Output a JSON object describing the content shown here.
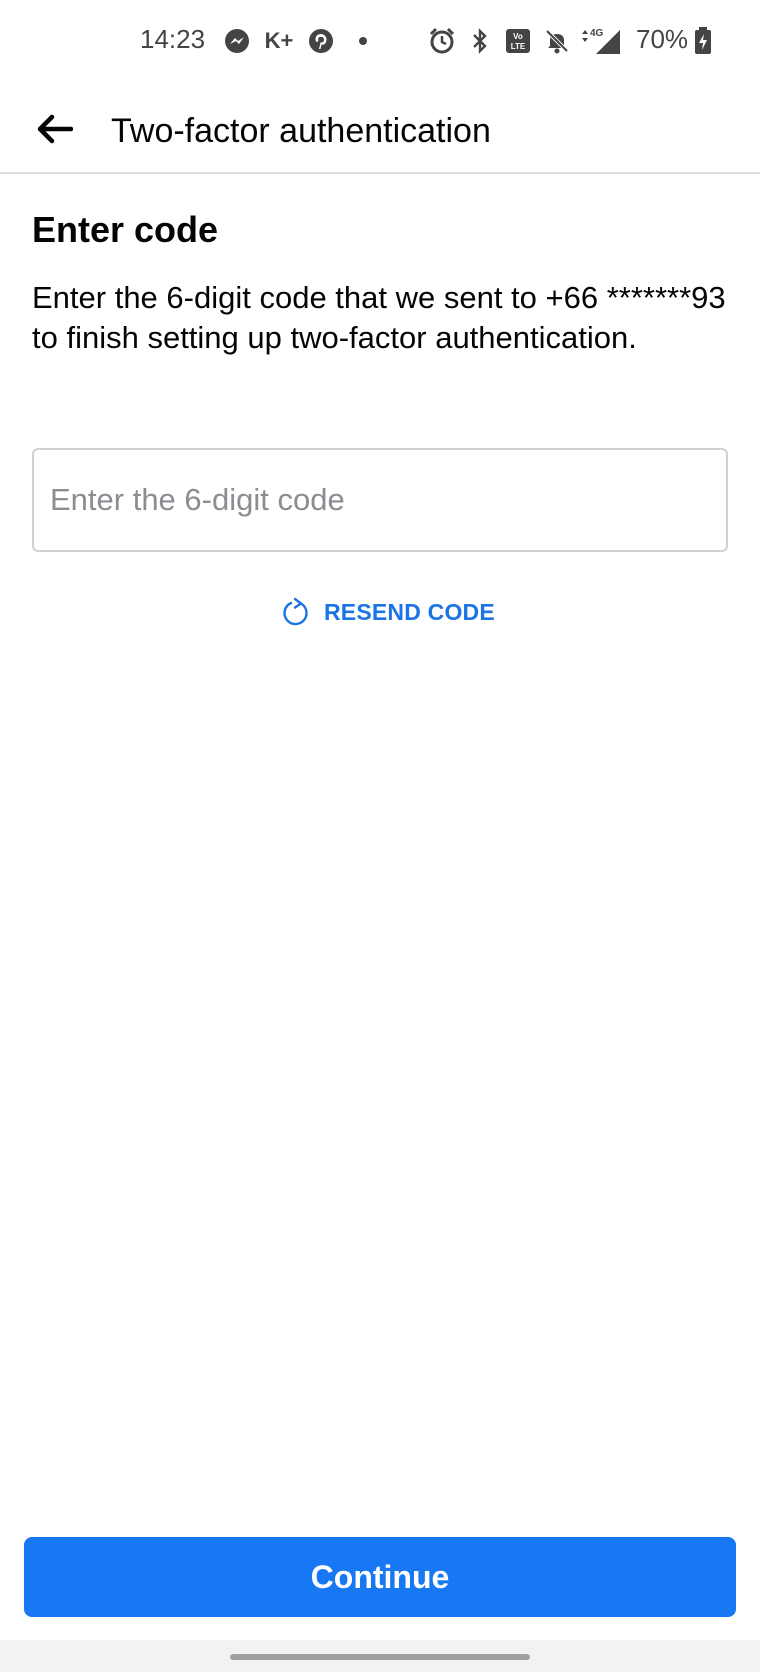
{
  "status_bar": {
    "time": "14:23",
    "battery_percent": "70%",
    "network": "4G",
    "left_icons": [
      "messenger-icon",
      "k-plus-icon",
      "pinterest-icon",
      "dot-icon"
    ],
    "right_icons": [
      "alarm-icon",
      "bluetooth-icon",
      "volte-icon",
      "mute-icon",
      "signal-icon",
      "battery-charging-icon"
    ],
    "k_plus_label": "K+"
  },
  "app_bar": {
    "back_icon": "arrow-left-icon",
    "title": "Two-factor authentication"
  },
  "main": {
    "heading": "Enter code",
    "description": "Enter the 6-digit code that we sent to +66 *******93 to finish setting up two-factor authentication.",
    "code_input": {
      "value": "",
      "placeholder": "Enter the 6-digit code"
    },
    "resend": {
      "icon": "refresh-icon",
      "label": "RESEND CODE"
    }
  },
  "footer": {
    "continue_label": "Continue"
  },
  "colors": {
    "accent": "#1877f2",
    "link": "#1b74e4",
    "text": "#050505",
    "placeholder": "#8a8d91",
    "border": "#ced0d4"
  }
}
